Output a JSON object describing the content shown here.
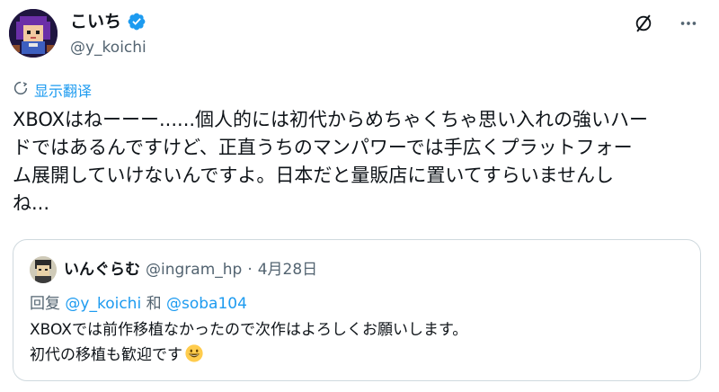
{
  "author": {
    "display_name": "こいち",
    "handle": "@y_koichi"
  },
  "translate_label": "显示翻译",
  "tweet_lines": [
    "XBOXはねーーー......個人的には初代からめちゃくちゃ思い入れの強いハー",
    "ドではあるんですけど、正直うちのマンパワーでは手広くプラットフォー",
    "ム展開していけないんですよ。日本だと量販店に置いてすらいませんし",
    "ね..."
  ],
  "quote": {
    "display_name": "いんぐらむ",
    "handle": "@ingram_hp",
    "dot": "·",
    "date": "4月28日",
    "reply_prefix": "回复",
    "reply_mention_1": "@y_koichi",
    "reply_and": "和",
    "reply_mention_2": "@soba104",
    "text_line_1": "XBOXでは前作移植なかったので次作はよろしくお願いします。",
    "text_line_2": "初代の移植も歓迎です"
  },
  "icons": {
    "verified": "verified-badge-icon",
    "grok": "grok-icon",
    "more": "more-options-icon",
    "translate": "translate-icon",
    "emoji": "grinning-face-emoji"
  },
  "colors": {
    "accent": "#1d9bf0",
    "text": "#0f1419",
    "secondary": "#536471",
    "border": "#cfd9de"
  }
}
